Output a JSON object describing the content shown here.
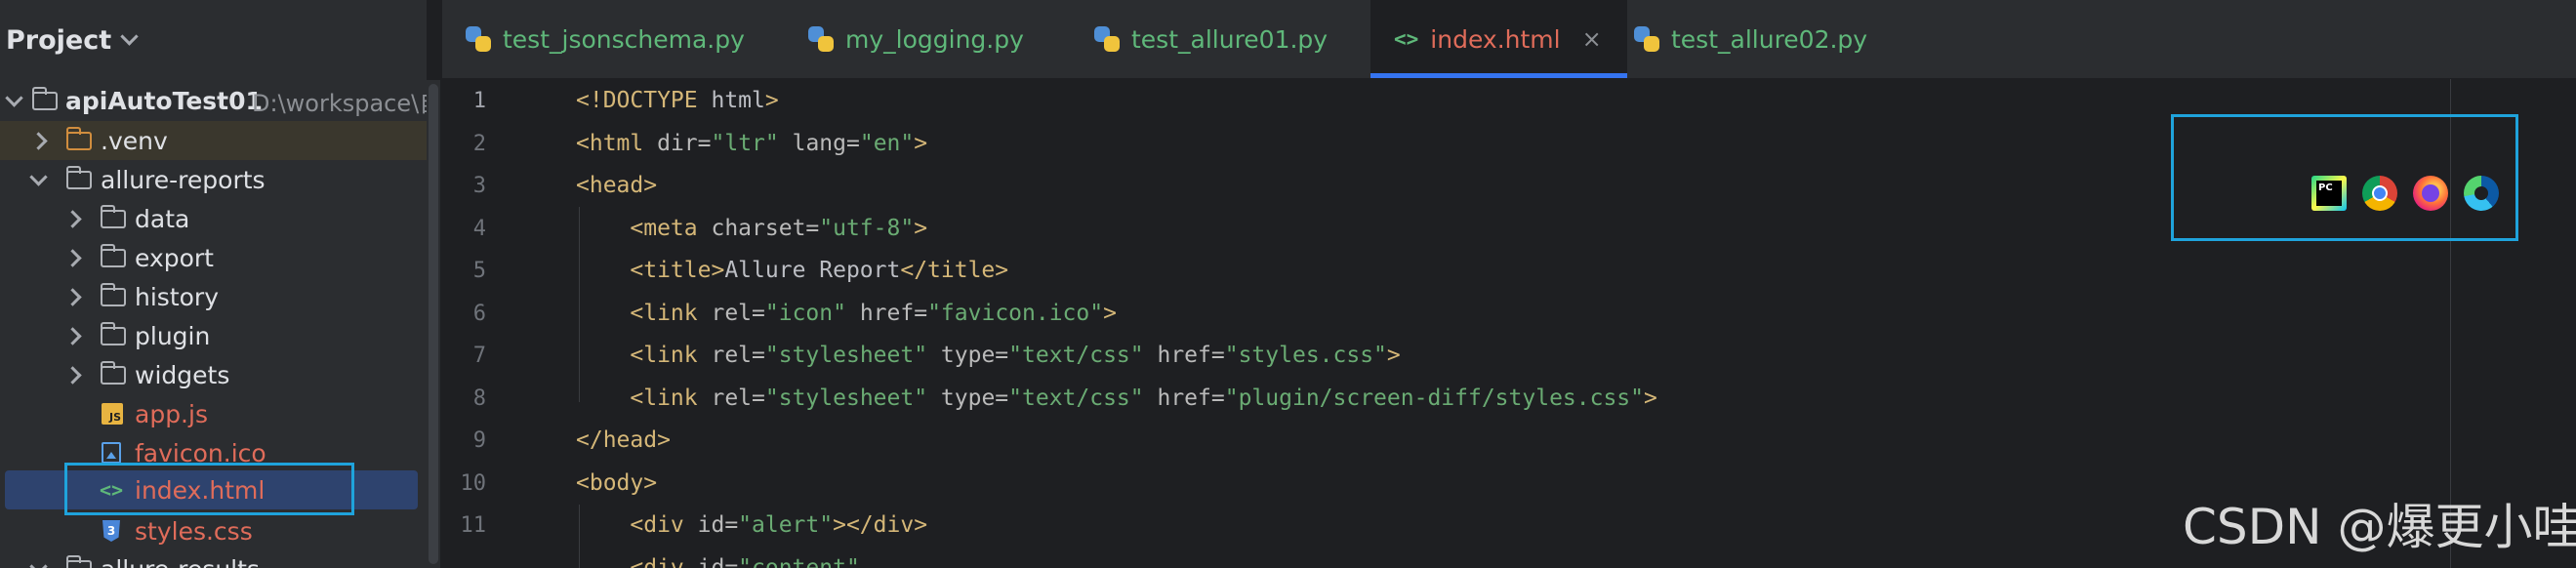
{
  "sidebar": {
    "title": "Project",
    "items": [
      {
        "label": "apiAutoTest01",
        "path": "D:\\workspace\\自动"
      },
      {
        "label": ".venv"
      },
      {
        "label": "allure-reports"
      },
      {
        "label": "data"
      },
      {
        "label": "export"
      },
      {
        "label": "history"
      },
      {
        "label": "plugin"
      },
      {
        "label": "widgets"
      },
      {
        "label": "app.js"
      },
      {
        "label": "favicon.ico"
      },
      {
        "label": "index.html"
      },
      {
        "label": "styles.css"
      },
      {
        "label": "allure-results"
      }
    ]
  },
  "tabs": [
    {
      "label": "test_jsonschema.py"
    },
    {
      "label": "my_logging.py"
    },
    {
      "label": "test_allure01.py"
    },
    {
      "label": "index.html",
      "close": "×"
    },
    {
      "label": "test_allure02.py"
    }
  ],
  "editor": {
    "line_numbers": [
      "1",
      "2",
      "3",
      "4",
      "5",
      "6",
      "7",
      "8",
      "9",
      "10",
      "11"
    ],
    "lines": [
      {
        "tag_open": "<!DOCTYPE",
        "text": " html",
        "tag_close": ">"
      },
      {
        "tag_open": "<html",
        "attr1": " dir=",
        "val1": "\"ltr\"",
        "attr2": " lang=",
        "val2": "\"en\"",
        "tag_close": ">"
      },
      {
        "tag_open": "<head>"
      },
      {
        "tag_open": "<meta",
        "attr1": " charset=",
        "val1": "\"utf-8\"",
        "tag_close": ">"
      },
      {
        "tag_open": "<title>",
        "text": "Allure Report",
        "tag_close": "</title>"
      },
      {
        "tag_open": "<link",
        "attr1": " rel=",
        "val1": "\"icon\"",
        "attr2": " href=",
        "val2": "\"favicon.ico\"",
        "tag_close": ">"
      },
      {
        "tag_open": "<link",
        "attr1": " rel=",
        "val1": "\"stylesheet\"",
        "attr2": " type=",
        "val2": "\"text/css\"",
        "attr3": " href=",
        "val3": "\"styles.css\"",
        "tag_close": ">"
      },
      {
        "tag_open": "<link",
        "attr1": " rel=",
        "val1": "\"stylesheet\"",
        "attr2": " type=",
        "val2": "\"text/css\"",
        "attr3": " href=",
        "val3": "\"plugin/screen-diff/styles.css\"",
        "tag_close": ">"
      },
      {
        "tag_open": "</head>"
      },
      {
        "tag_open": "<body>"
      },
      {
        "tag_open": "<div",
        "attr1": " id=",
        "val1": "\"alert\"",
        "tag_close": "></div>"
      },
      {
        "tag_open": "<div",
        "attr1": " id=",
        "val1": "\"content\""
      }
    ]
  },
  "browser_icons": [
    "pycharm-icon",
    "chrome-icon",
    "firefox-icon",
    "edge-icon"
  ],
  "watermark": "CSDN @爆更小哇",
  "colors": {
    "accent": "#3574f0",
    "highlight_box": "#1fa3dc",
    "tag": "#d5b778",
    "string": "#6aab73",
    "modified_file": "#e06c5a"
  }
}
